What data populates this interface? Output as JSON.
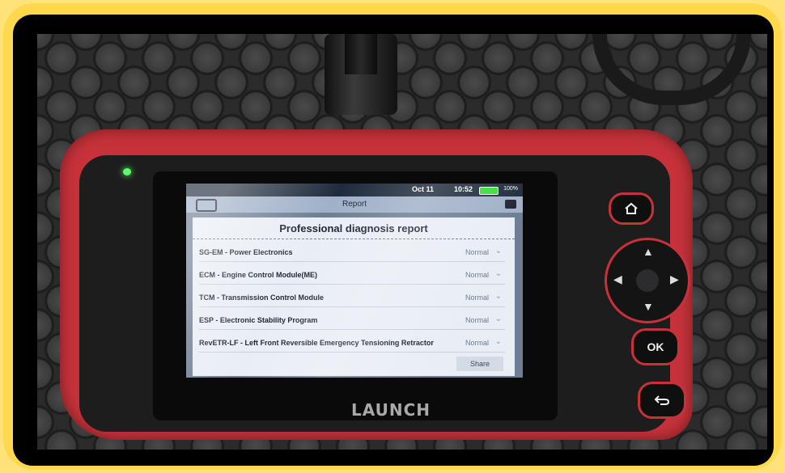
{
  "screen": {
    "status": {
      "date": "Oct 11",
      "time": "10:52",
      "battery": "100%"
    },
    "title": "Report",
    "report": {
      "heading": "Professional diagnosis report",
      "rows": [
        {
          "name": "SG-EM - Power Electronics",
          "value": "Normal"
        },
        {
          "name": "ECM - Engine Control Module(ME)",
          "value": "Normal"
        },
        {
          "name": "TCM - Transmission Control Module",
          "value": "Normal"
        },
        {
          "name": "ESP - Electronic Stability Program",
          "value": "Normal"
        },
        {
          "name": "RevETR-LF - Left Front Reversible Emergency Tensioning Retractor",
          "value": "Normal"
        }
      ],
      "share_label": "Share"
    }
  },
  "device": {
    "brand": "LAUNCH",
    "ok_label": "OK"
  }
}
